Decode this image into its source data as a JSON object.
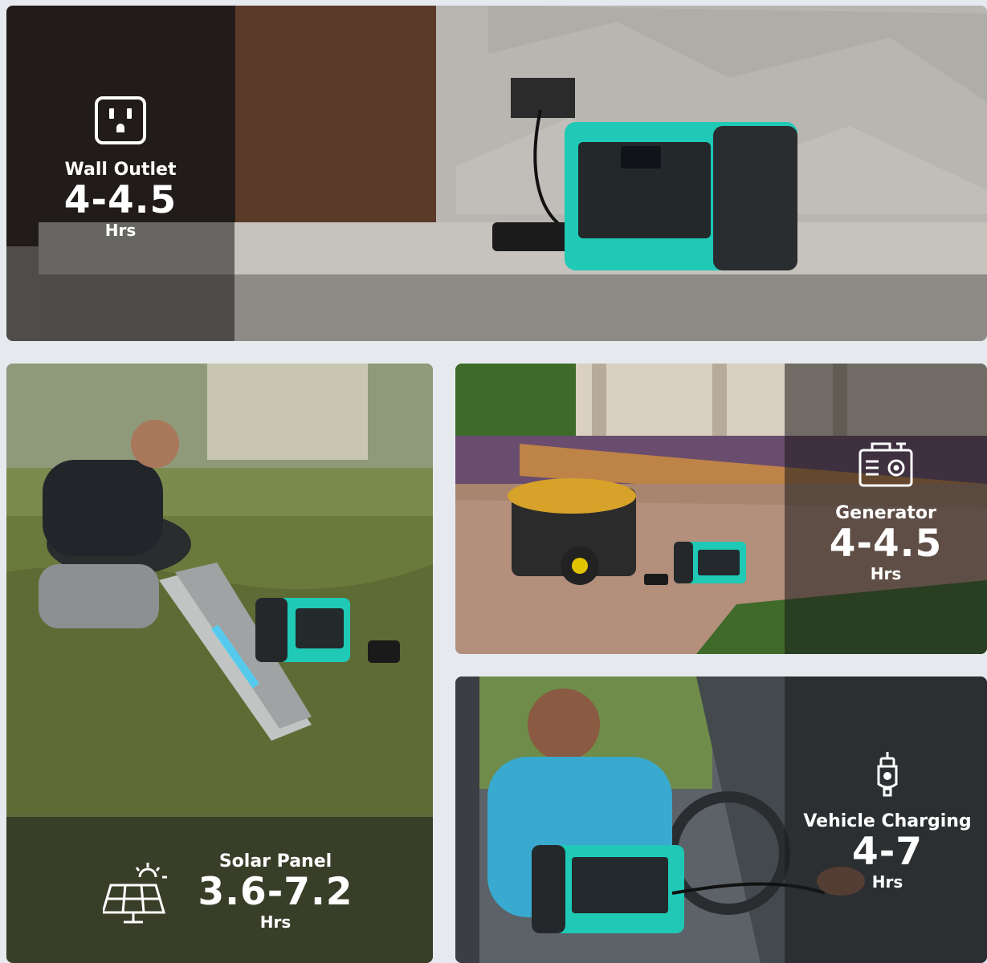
{
  "panels": {
    "wall": {
      "label": "Wall Outlet",
      "time": "4-4.5",
      "unit": "Hrs",
      "icon": "outlet-icon"
    },
    "solar": {
      "label": "Solar Panel",
      "time": "3.6-7.2",
      "unit": "Hrs",
      "icon": "solar-panel-icon"
    },
    "generator": {
      "label": "Generator",
      "time": "4-4.5",
      "unit": "Hrs",
      "icon": "generator-icon"
    },
    "vehicle": {
      "label": "Vehicle Charging",
      "time": "4-7",
      "unit": "Hrs",
      "icon": "car-charger-icon"
    }
  },
  "colors": {
    "accent": "#1fc9b6",
    "overlay": "#191919",
    "background": "#e6eaef"
  }
}
